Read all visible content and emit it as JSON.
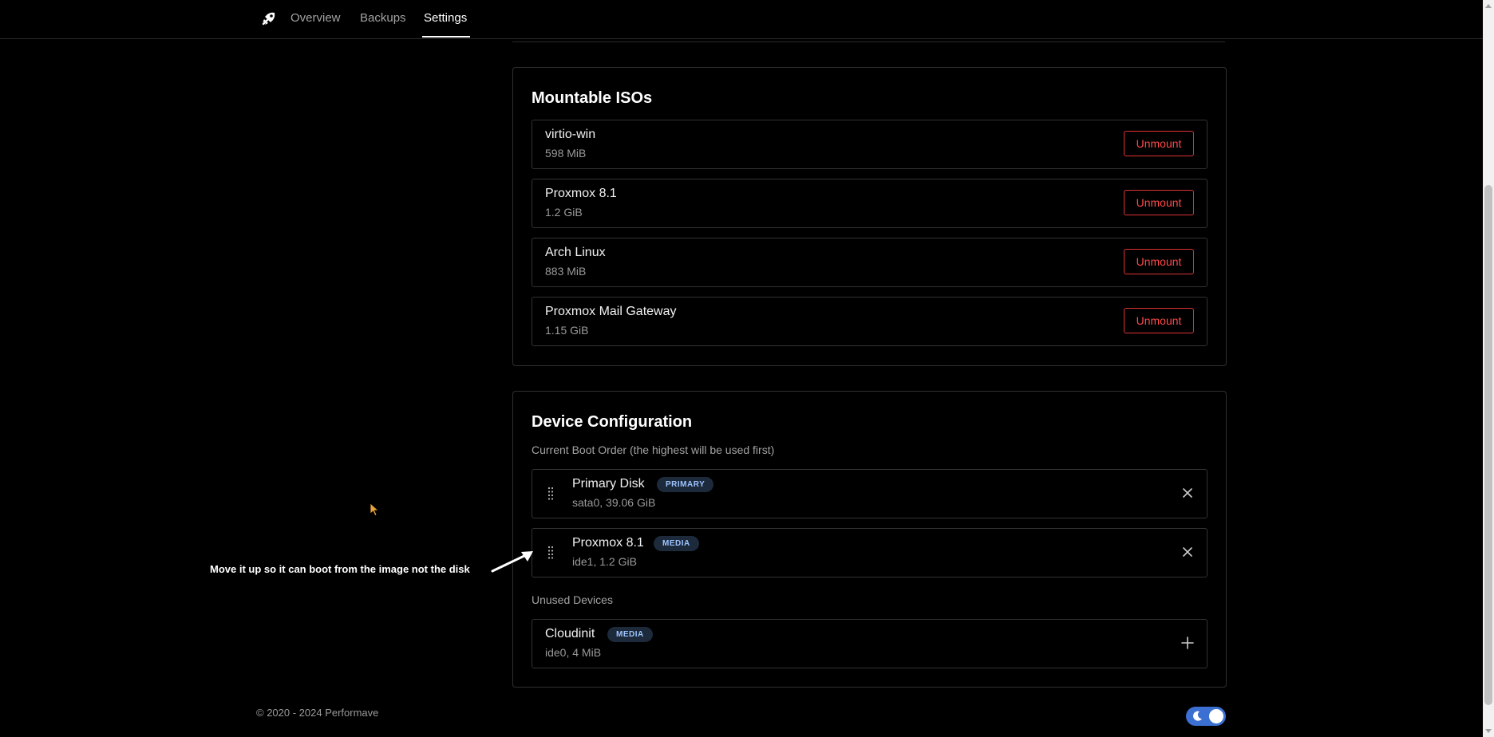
{
  "nav": {
    "tabs": [
      {
        "label": "Overview"
      },
      {
        "label": "Backups"
      },
      {
        "label": "Settings"
      }
    ],
    "active_tab": "Settings"
  },
  "mountable_isos": {
    "title": "Mountable ISOs",
    "unmount_label": "Unmount",
    "items": [
      {
        "name": "virtio-win",
        "size": "598 MiB"
      },
      {
        "name": "Proxmox 8.1",
        "size": "1.2 GiB"
      },
      {
        "name": "Arch Linux",
        "size": "883 MiB"
      },
      {
        "name": "Proxmox Mail Gateway",
        "size": "1.15 GiB"
      }
    ]
  },
  "device_config": {
    "title": "Device Configuration",
    "boot_order_label": "Current Boot Order (the highest will be used first)",
    "boot_devices": [
      {
        "name": "Primary Disk",
        "badge": "PRIMARY",
        "detail": "sata0, 39.06 GiB"
      },
      {
        "name": "Proxmox 8.1",
        "badge": "MEDIA",
        "detail": "ide1, 1.2 GiB"
      }
    ],
    "unused_label": "Unused Devices",
    "unused_devices": [
      {
        "name": "Cloudinit",
        "badge": "MEDIA",
        "detail": "ide0, 4 MiB"
      }
    ]
  },
  "annotation": {
    "text": "Move it up so it can boot from the image not the disk"
  },
  "footer": {
    "copyright": "© 2020 - 2024 Performave"
  },
  "colors": {
    "background": "#000000",
    "danger": "#ff4a4a",
    "badge_bg": "#1d2a3b",
    "badge_text": "#9dc4ff",
    "toggle": "#3b6fd1",
    "cursor": "#e8a33a"
  },
  "icons": {
    "logo": "rocket-wrench-icon",
    "drag": "drag-handle-icon",
    "remove": "close-icon",
    "add": "plus-icon",
    "theme": "moon-icon"
  }
}
